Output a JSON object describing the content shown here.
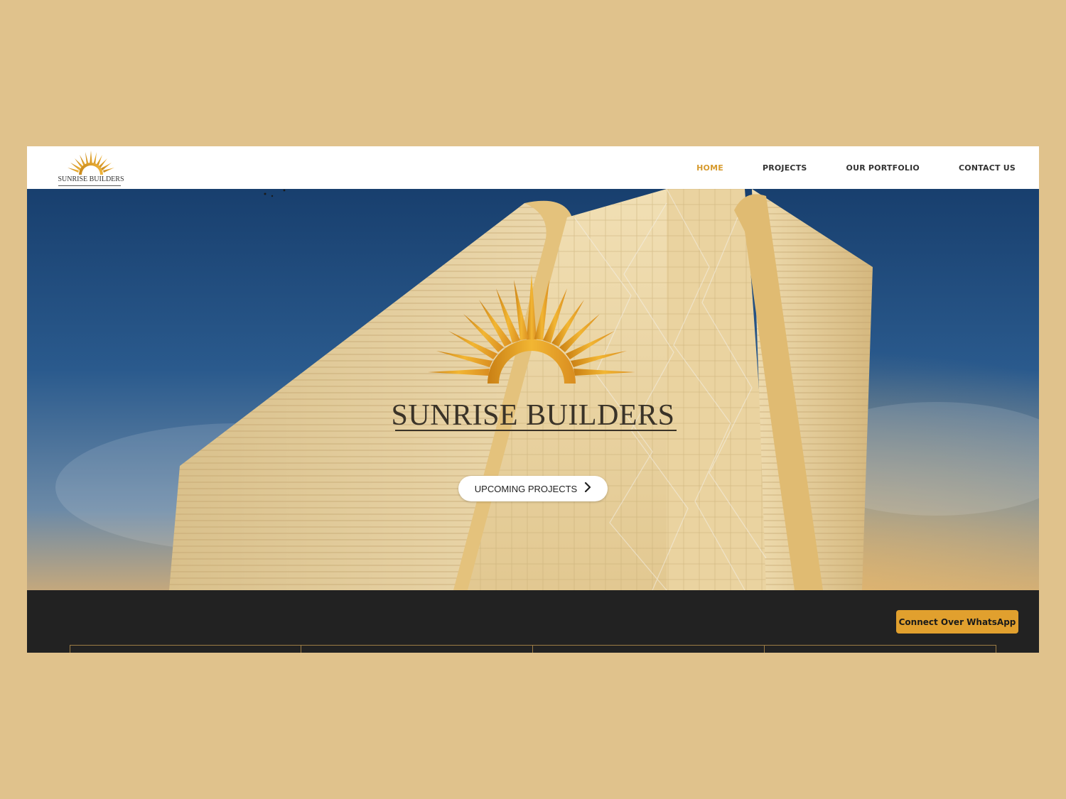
{
  "brand": {
    "logo_text": "SUNRISE BUILDERS",
    "hero_title": "SUNRISE BUILDERS",
    "accent_color": "#d69a2d"
  },
  "nav": {
    "items": [
      {
        "label": "HOME",
        "active": true
      },
      {
        "label": "PROJECTS",
        "active": false
      },
      {
        "label": "OUR PORTFOLIO",
        "active": false
      },
      {
        "label": "CONTACT US",
        "active": false
      }
    ]
  },
  "hero": {
    "cta_label": "UPCOMING PROJECTS",
    "cta_icon": "chevron-right-icon"
  },
  "footer": {
    "whatsapp_label": "Connect Over WhatsApp"
  },
  "colors": {
    "page_background": "#e0c28c",
    "dark_section": "#222222",
    "whatsapp_button": "#e1a02e"
  }
}
